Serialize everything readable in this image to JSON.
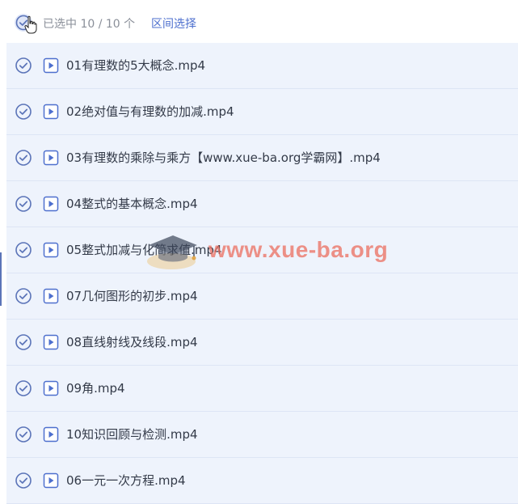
{
  "header": {
    "selection_text": "已选中 10 / 10 个",
    "range_select_label": "区间选择"
  },
  "files": [
    {
      "name": "01有理数的5大概念.mp4"
    },
    {
      "name": "02绝对值与有理数的加减.mp4"
    },
    {
      "name": "03有理数的乘除与乘方【www.xue-ba.org学霸网】.mp4"
    },
    {
      "name": "04整式的基本概念.mp4"
    },
    {
      "name": "05整式加减与化简求值.mp4"
    },
    {
      "name": "07几何图形的初步.mp4"
    },
    {
      "name": "08直线射线及线段.mp4"
    },
    {
      "name": "09角.mp4"
    },
    {
      "name": "10知识回顾与检测.mp4"
    },
    {
      "name": "06一元一次方程.mp4"
    }
  ],
  "watermark": {
    "text": "www.xue-ba.org"
  },
  "colors": {
    "accent": "#4d6fce",
    "row_bg": "#eef3fc",
    "watermark": "#eb6e5f"
  },
  "icons": {
    "check": "check-circle-icon",
    "file": "video-file-icon",
    "cursor": "hand-pointer-icon"
  }
}
